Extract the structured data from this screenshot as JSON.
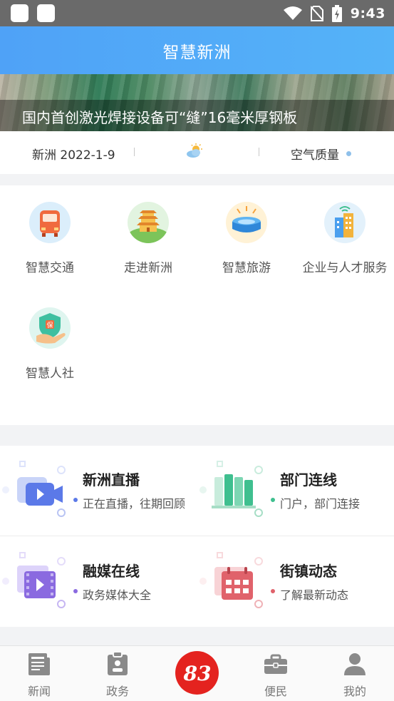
{
  "status_bar": {
    "time": "9:43"
  },
  "header": {
    "title": "智慧新洲"
  },
  "banner": {
    "caption": "国内首创激光焊接设备可“缝”16毫米厚钢板"
  },
  "info_bar": {
    "date": "新洲 2022-1-9",
    "air_quality_label": "空气质量",
    "weather_icon": "partly-cloudy-icon"
  },
  "services": [
    {
      "label": "智慧交通",
      "icon": "bus-icon"
    },
    {
      "label": "走进新洲",
      "icon": "pagoda-icon"
    },
    {
      "label": "智慧旅游",
      "icon": "stadium-icon"
    },
    {
      "label": "企业与人才服务",
      "icon": "building-icon"
    },
    {
      "label": "智慧人社",
      "icon": "insurance-shield-icon"
    }
  ],
  "features": [
    {
      "title": "新洲直播",
      "subtitle": "正在直播，往期回顾",
      "icon": "video-camera-icon",
      "color": "#5b79e8"
    },
    {
      "title": "部门连线",
      "subtitle": "门户，部门连接",
      "icon": "books-icon",
      "color": "#3fbf8f"
    },
    {
      "title": "融媒在线",
      "subtitle": "政务媒体大全",
      "icon": "film-play-icon",
      "color": "#8a6ae0"
    },
    {
      "title": "街镇动态",
      "subtitle": "了解最新动态",
      "icon": "calendar-icon",
      "color": "#e0626b"
    }
  ],
  "bottom_nav": {
    "items": [
      {
        "label": "新闻",
        "icon": "newspaper-icon"
      },
      {
        "label": "政务",
        "icon": "clipboard-badge-icon"
      },
      {
        "label": "便民",
        "icon": "briefcase-icon"
      },
      {
        "label": "我的",
        "icon": "person-icon"
      }
    ],
    "center_logo_text": "83"
  }
}
